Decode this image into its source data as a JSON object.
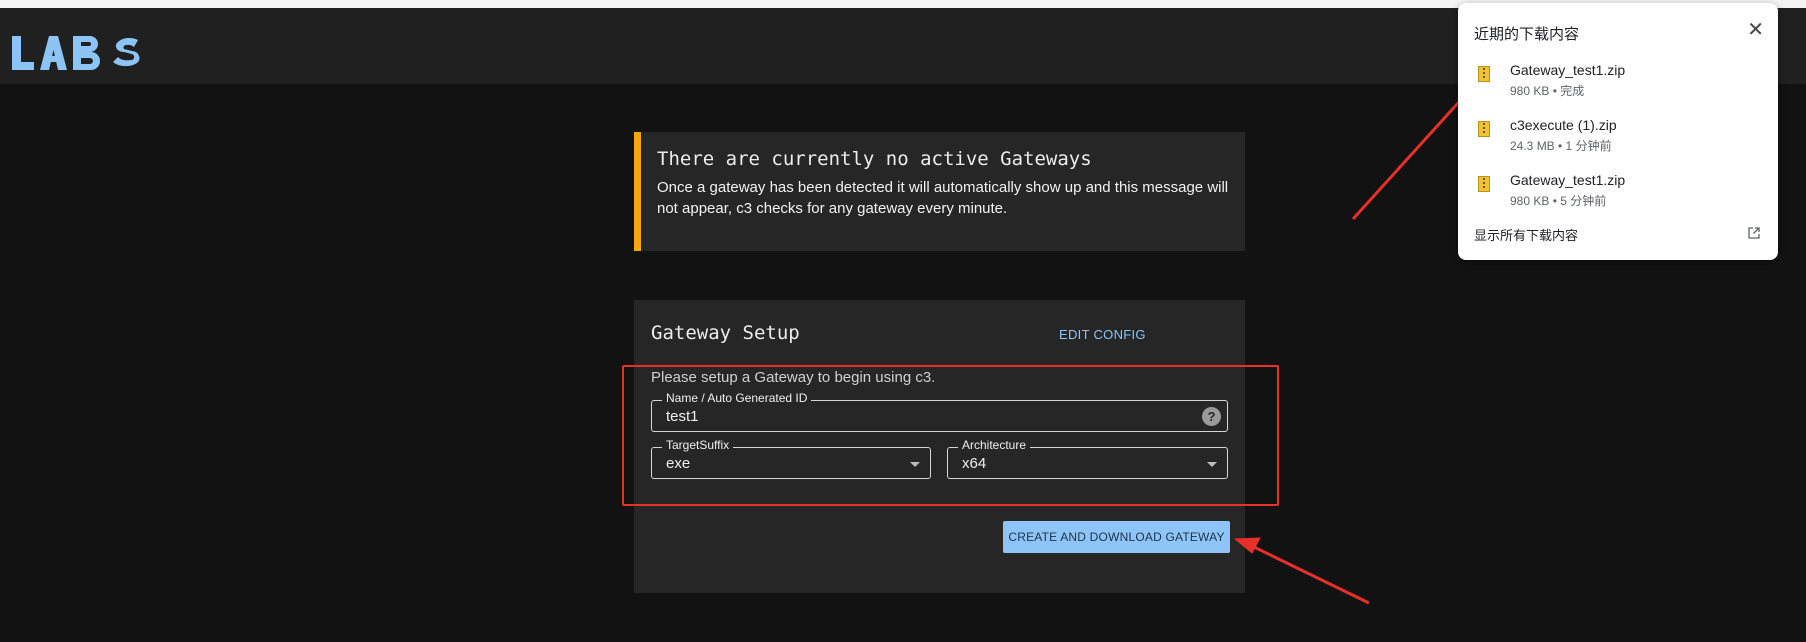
{
  "header": {
    "logo_text": "LABS"
  },
  "alert": {
    "title": "There are currently no active Gateways",
    "body": "Once a gateway has been detected it will automatically show up and this message will not appear, c3 checks for any gateway every minute."
  },
  "gateway_setup": {
    "title": "Gateway Setup",
    "edit_config_label": "EDIT CONFIG",
    "subtitle": "Please setup a Gateway to begin using c3.",
    "name_field": {
      "label": "Name / Auto Generated ID",
      "value": "test1"
    },
    "target_suffix": {
      "label": "TargetSuffix",
      "value": "exe"
    },
    "architecture": {
      "label": "Architecture",
      "value": "x64"
    },
    "create_button_label": "CREATE AND DOWNLOAD GATEWAY"
  },
  "downloads": {
    "title": "近期的下载内容",
    "close_label": "✕",
    "items": [
      {
        "name": "Gateway_test1.zip",
        "meta": "980 KB • 完成"
      },
      {
        "name": "c3execute (1).zip",
        "meta": "24.3 MB • 1 分钟前"
      },
      {
        "name": "Gateway_test1.zip",
        "meta": "980 KB • 5 分钟前"
      }
    ],
    "show_all_label": "显示所有下载内容"
  },
  "colors": {
    "alert_accent": "#f5a60a",
    "button_bg": "#8ec5f8",
    "annotation_red": "#e8302a",
    "link": "#8cc4f5"
  }
}
